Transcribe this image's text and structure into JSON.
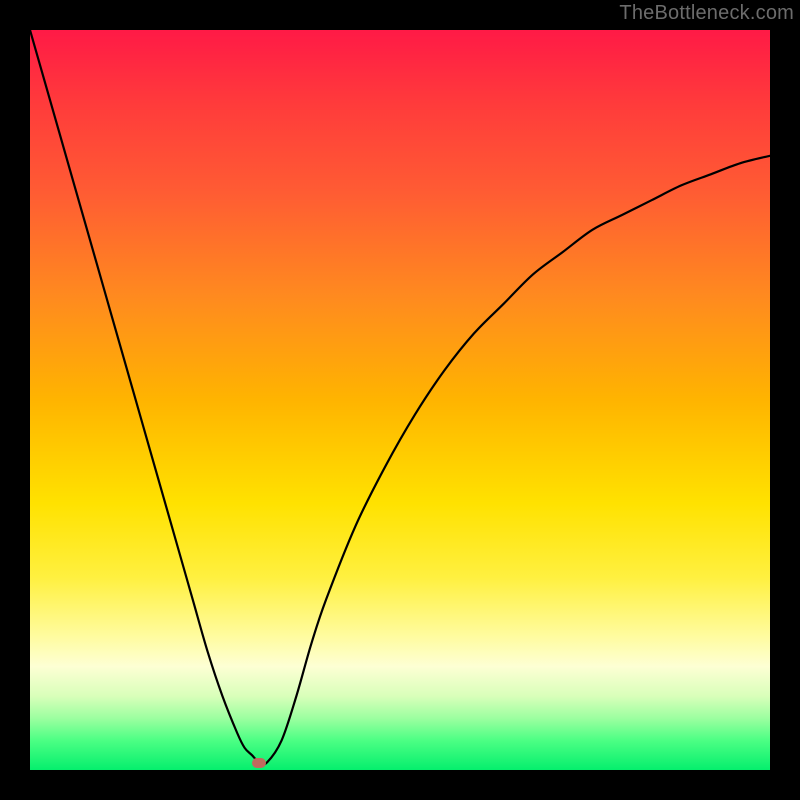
{
  "watermark": "TheBottleneck.com",
  "accent_marker_color": "#c06a5e",
  "chart_data": {
    "type": "line",
    "title": "",
    "xlabel": "",
    "ylabel": "",
    "xlim": [
      0,
      100
    ],
    "ylim": [
      0,
      100
    ],
    "grid": false,
    "legend": false,
    "x": [
      0,
      2,
      4,
      6,
      8,
      10,
      12,
      14,
      16,
      18,
      20,
      22,
      24,
      26,
      28,
      29,
      30,
      31,
      32,
      34,
      36,
      38,
      40,
      44,
      48,
      52,
      56,
      60,
      64,
      68,
      72,
      76,
      80,
      84,
      88,
      92,
      96,
      100
    ],
    "values": [
      100,
      93,
      86,
      79,
      72,
      65,
      58,
      51,
      44,
      37,
      30,
      23,
      16,
      10,
      5,
      3,
      2,
      1,
      1,
      4,
      10,
      17,
      23,
      33,
      41,
      48,
      54,
      59,
      63,
      67,
      70,
      73,
      75,
      77,
      79,
      80.5,
      82,
      83
    ],
    "min_marker": {
      "x": 31,
      "y": 1
    }
  }
}
